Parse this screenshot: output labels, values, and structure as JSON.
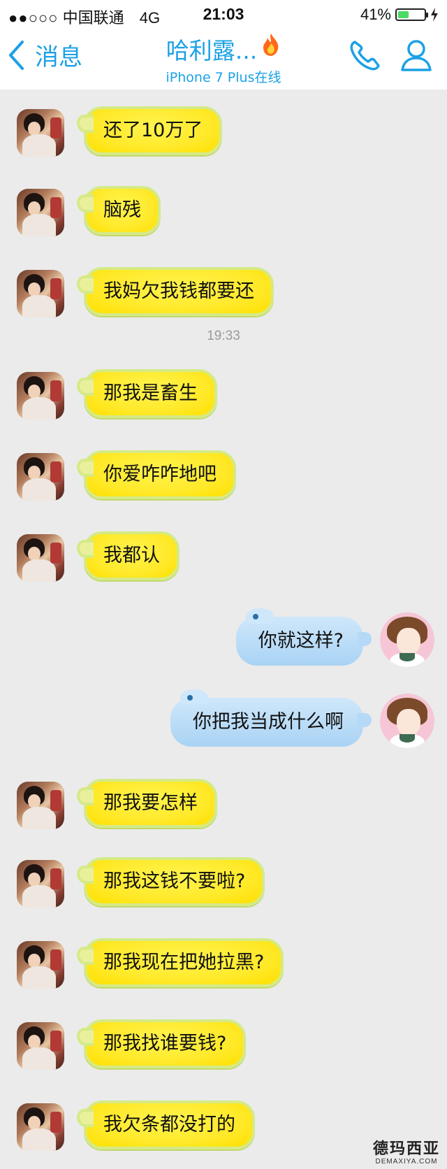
{
  "status_bar": {
    "signal": "●●○○○",
    "carrier": "中国联通",
    "network": "4G",
    "time": "21:03",
    "battery_percent": "41%",
    "battery_level": 0.41
  },
  "nav": {
    "back_label": "消息",
    "title": "哈利露...",
    "subtitle": "iPhone 7 Plus在线",
    "title_icon": "fire-icon",
    "phone_icon": "phone-icon",
    "profile_icon": "profile-icon"
  },
  "messages": [
    {
      "side": "in",
      "text": "还了10万了"
    },
    {
      "side": "in",
      "text": "脑残"
    },
    {
      "side": "in",
      "text": "我妈欠我钱都要还"
    },
    {
      "side": "in",
      "text": "那我是畜生"
    },
    {
      "side": "in",
      "text": "你爱咋咋地吧"
    },
    {
      "side": "in",
      "text": "我都认"
    },
    {
      "side": "out",
      "text": "你就这样?"
    },
    {
      "side": "out",
      "text": "你把我当成什么啊"
    },
    {
      "side": "in",
      "text": "那我要怎样"
    },
    {
      "side": "in",
      "text": "那我这钱不要啦?"
    },
    {
      "side": "in",
      "text": "那我现在把她拉黑?"
    },
    {
      "side": "in",
      "text": "那我找谁要钱?"
    },
    {
      "side": "in",
      "text": "我欠条都没打的"
    }
  ],
  "timestamp": "19:33",
  "watermark": "德玛西亚",
  "watermark_domain": "DEMAXIYA.COM",
  "colors": {
    "accent": "#1ba1e6",
    "incoming_bubble": "#ffe92a",
    "outgoing_bubble": "#b5d9f6"
  }
}
